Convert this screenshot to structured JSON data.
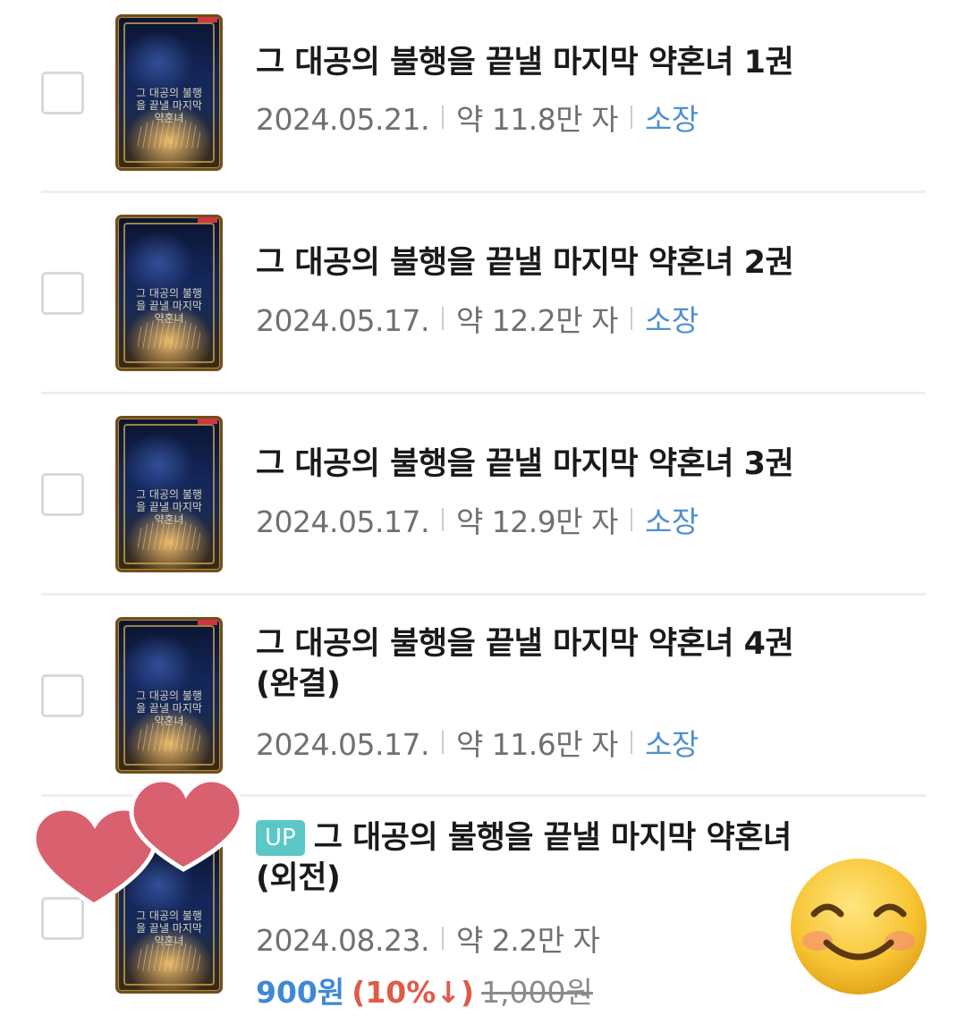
{
  "items": [
    {
      "title_line1": "그 대공의 불행을 끝낼 마지막 약혼녀 1권",
      "date": "2024.05.21.",
      "length": "약 11.8만 자",
      "status": "소장",
      "cover_text": "그 대공의 불행을 끝낼 마지막 약혼녀"
    },
    {
      "title_line1": "그 대공의 불행을 끝낼 마지막 약혼녀 2권",
      "date": "2024.05.17.",
      "length": "약 12.2만 자",
      "status": "소장",
      "cover_text": "그 대공의 불행을 끝낼 마지막 약혼녀"
    },
    {
      "title_line1": "그 대공의 불행을 끝낼 마지막 약혼녀 3권",
      "date": "2024.05.17.",
      "length": "약 12.9만 자",
      "status": "소장",
      "cover_text": "그 대공의 불행을 끝낼 마지막 약혼녀"
    },
    {
      "title_line1": "그 대공의 불행을 끝낼 마지막 약혼녀 4권",
      "title_line2": "(완결)",
      "date": "2024.05.17.",
      "length": "약 11.6만 자",
      "status": "소장",
      "cover_text": "그 대공의 불행을 끝낼 마지막 약혼녀"
    },
    {
      "badge": "UP",
      "title_line1": "그 대공의 불행을 끝낼 마지막 약혼녀",
      "title_line2": "(외전)",
      "date": "2024.08.23.",
      "length": "약 2.2만 자",
      "sale_price": "900원",
      "discount": "(10%↓)",
      "original_price": "1,000원",
      "cover_text": "그 대공의 불행을 끝낼 마지막 약혼녀"
    }
  ],
  "colors": {
    "owned": "#4f8fd1",
    "sale": "#3f88d6",
    "discount": "#e05a4a",
    "badge": "#5cc7c7",
    "heart": "#d9606e"
  },
  "icons": {
    "sticker_hearts": "heart-icon",
    "sticker_emoji": "smiling-face-icon"
  }
}
